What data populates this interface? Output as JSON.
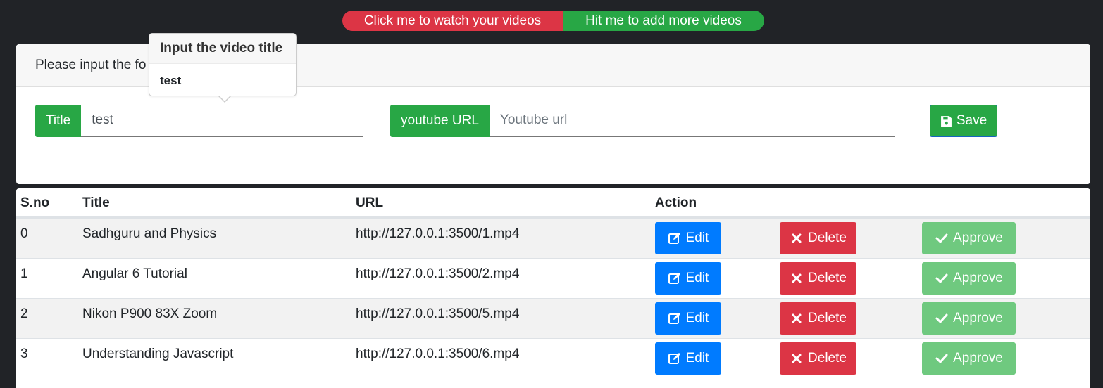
{
  "nav": {
    "watch_label": "Click me to watch your videos",
    "add_label": "Hit me to add more videos",
    "watch_color": "#dc3545",
    "add_color": "#28a745"
  },
  "form": {
    "header_visible_text": "Please input the fo",
    "title_label": "Title",
    "title_value": "test",
    "url_label": "youtube URL",
    "url_placeholder": "Youtube url",
    "save_label": "Save",
    "save_icon": "floppy-disk-icon"
  },
  "popover": {
    "title": "Input the video title",
    "body": "test"
  },
  "table": {
    "headers": {
      "sno": "S.no",
      "title": "Title",
      "url": "URL",
      "action": "Action"
    },
    "edit_label": "Edit",
    "delete_label": "Delete",
    "approve_label": "Approve",
    "rows": [
      {
        "sno": "0",
        "title": "Sadhguru and Physics",
        "url": "http://127.0.0.1:3500/1.mp4"
      },
      {
        "sno": "1",
        "title": "Angular 6 Tutorial",
        "url": "http://127.0.0.1:3500/2.mp4"
      },
      {
        "sno": "2",
        "title": "Nikon P900 83X Zoom",
        "url": "http://127.0.0.1:3500/5.mp4"
      },
      {
        "sno": "3",
        "title": "Understanding Javascript",
        "url": "http://127.0.0.1:3500/6.mp4"
      }
    ]
  }
}
